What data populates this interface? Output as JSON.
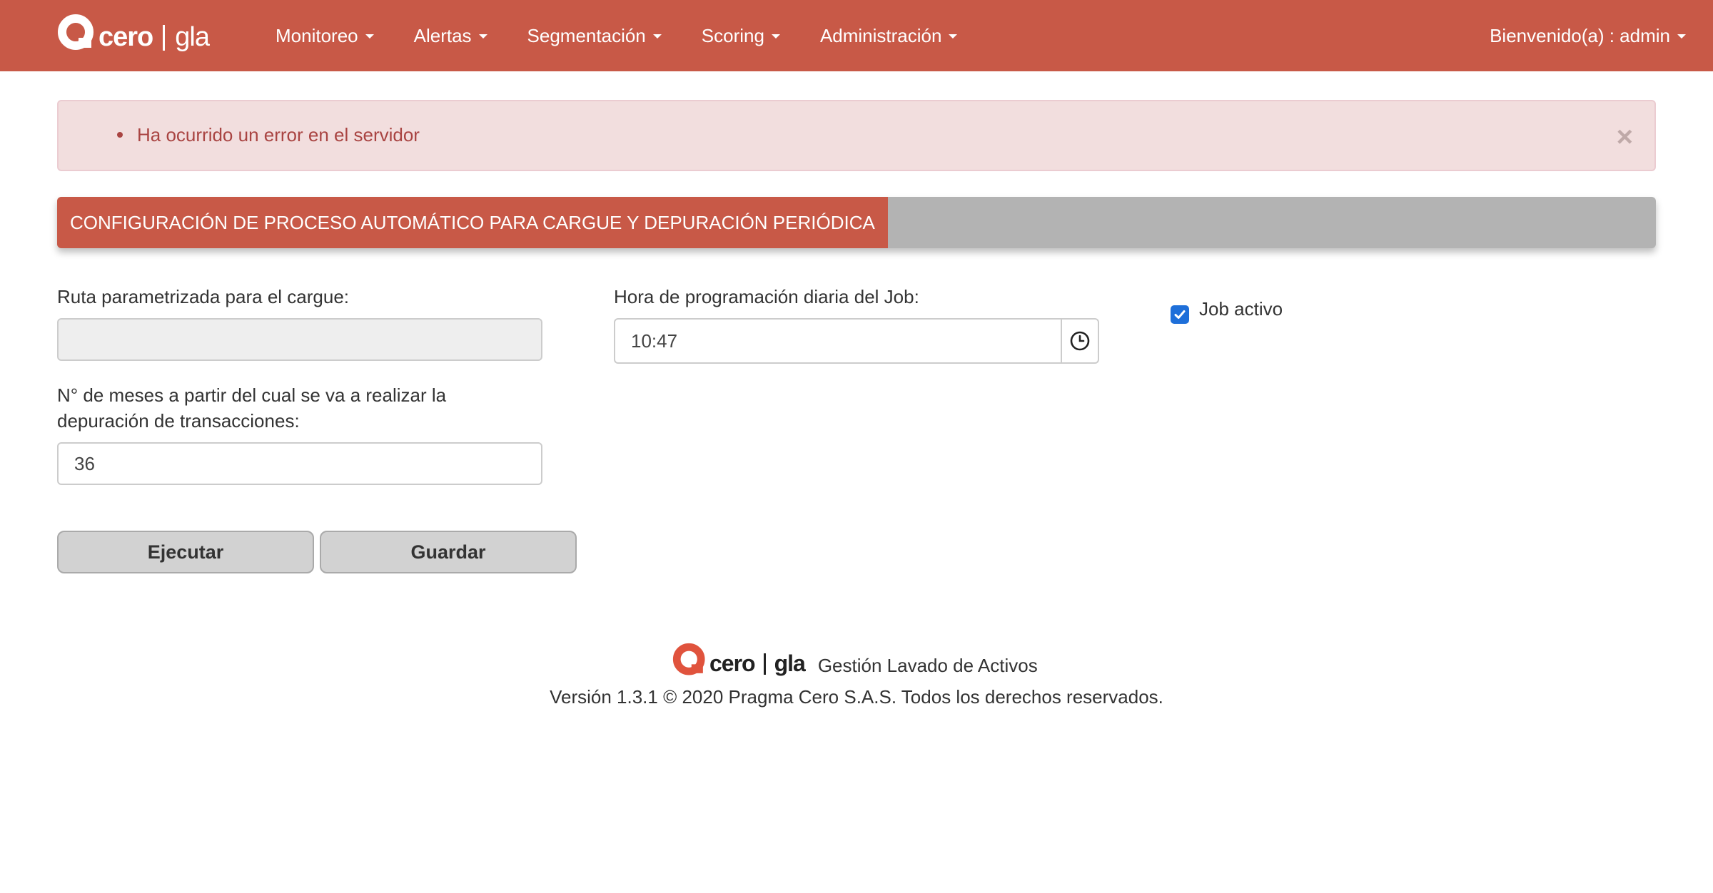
{
  "brand": {
    "name": "cero",
    "product": "gla"
  },
  "nav": {
    "items": [
      {
        "label": "Monitoreo"
      },
      {
        "label": "Alertas"
      },
      {
        "label": "Segmentación"
      },
      {
        "label": "Scoring"
      },
      {
        "label": "Administración"
      }
    ],
    "user_label": "Bienvenido(a) : admin"
  },
  "alert": {
    "message": "Ha ocurrido un error en el servidor",
    "close_label": "×"
  },
  "section": {
    "title": "CONFIGURACIÓN DE PROCESO AUTOMÁTICO PARA CARGUE Y DEPURACIÓN PERIÓDICA"
  },
  "form": {
    "route_label": "Ruta parametrizada para el cargue:",
    "route_value": "",
    "months_label_line1": "N° de meses a partir del cual se va a realizar la",
    "months_label_line2": "depuración de transacciones:",
    "months_value": "36",
    "schedule_label": "Hora de programación diaria del Job:",
    "schedule_value": "10:47",
    "job_active_label": "Job activo",
    "job_active_checked": true
  },
  "buttons": {
    "execute": "Ejecutar",
    "save": "Guardar"
  },
  "footer": {
    "tagline": "Gestión Lavado de Activos",
    "version": "Versión 1.3.1 © 2020 Pragma Cero S.A.S. Todos los derechos reservados."
  },
  "colors": {
    "brand": "#c85947",
    "alert_bg": "#f2dede",
    "alert_text": "#a94442",
    "header_gray": "#b3b3b3",
    "checkbox": "#1e6fd9"
  }
}
